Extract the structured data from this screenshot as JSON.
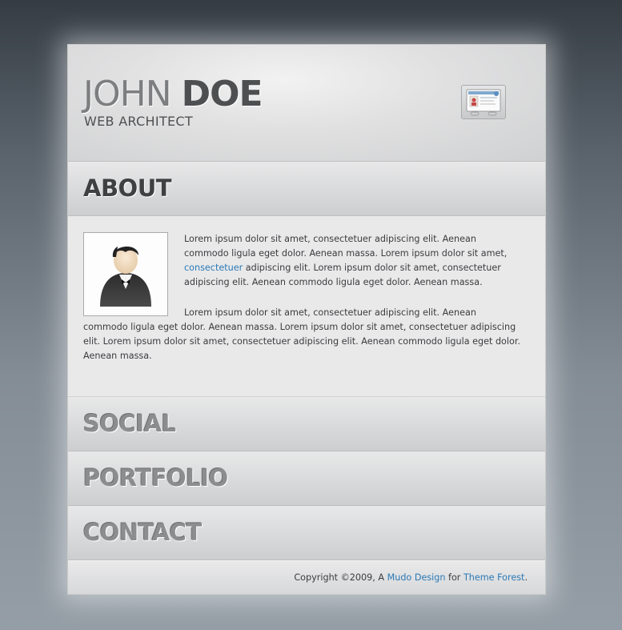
{
  "header": {
    "first_name": "JOHN",
    "last_name": "DOE",
    "subtitle": "WEB ARCHITECT",
    "vcard_icon": "vcard-icon"
  },
  "sections": {
    "about": "ABOUT",
    "social": "SOCIAL",
    "portfolio": "PORTFOLIO",
    "contact": "CONTACT"
  },
  "about": {
    "avatar_icon": "person-avatar-icon",
    "p1_before_link": "Lorem ipsum dolor sit amet, consectetuer adipiscing elit. Aenean commodo ligula eget dolor. Aenean massa. Lorem ipsum dolor sit amet, ",
    "p1_link": "consectetuer",
    "p1_after_link": " adipiscing elit. Lorem ipsum dolor sit amet, consectetuer adipiscing elit. Aenean commodo ligula eget dolor. Aenean massa.",
    "p2": "Lorem ipsum dolor sit amet, consectetuer adipiscing elit. Aenean commodo ligula eget dolor. Aenean massa. Lorem ipsum dolor sit amet, consectetuer adipiscing elit. Lorem ipsum dolor sit amet, consectetuer adipiscing elit. Aenean commodo ligula eget dolor. Aenean massa."
  },
  "footer": {
    "copyright": "Copyright ©2009, A ",
    "design_link": "Mudo Design",
    "for_text": " for ",
    "forest_link": "Theme Forest",
    "end": "."
  },
  "colors": {
    "link": "#2a79b6",
    "background_top": "#353c44",
    "background_bottom": "#959ea6"
  }
}
